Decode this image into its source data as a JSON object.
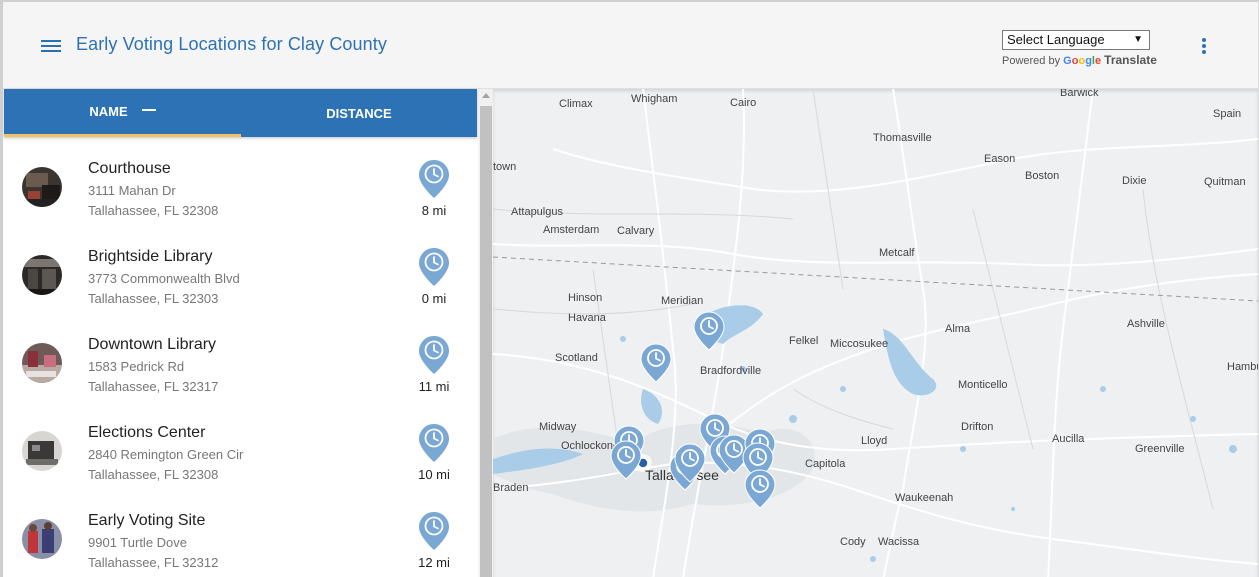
{
  "header": {
    "title": "Early Voting Locations for Clay County",
    "language_select": "Select Language",
    "powered_by": "Powered by",
    "google": [
      "G",
      "o",
      "o",
      "g",
      "l",
      "e"
    ],
    "translate": "Translate"
  },
  "tabs": {
    "name": "NAME",
    "distance": "DISTANCE"
  },
  "locations": [
    {
      "name": "Courthouse",
      "address": "3111 Mahan Dr",
      "city": "Tallahassee, FL 32308",
      "distance": "8 mi"
    },
    {
      "name": "Brightside Library",
      "address": "3773 Commonwealth Blvd",
      "city": "Tallahassee, FL 32303",
      "distance": "0 mi"
    },
    {
      "name": "Downtown Library",
      "address": "1583 Pedrick Rd",
      "city": "Tallahassee, FL 32317",
      "distance": "11 mi"
    },
    {
      "name": "Elections Center",
      "address": "2840 Remington Green Cir",
      "city": "Tallahassee, FL 32308",
      "distance": "10 mi"
    },
    {
      "name": "Early Voting Site",
      "address": "9901 Turtle Dove",
      "city": "Tallahassee, FL 32312",
      "distance": "12 mi"
    }
  ],
  "map": {
    "places": [
      "Climax",
      "Whigham",
      "Cairo",
      "Barwick",
      "Spain",
      "Thomasville",
      "town",
      "Eason",
      "Boston",
      "Dixie",
      "Quitman",
      "Attapulgus",
      "Amsterdam",
      "Calvary",
      "Metcalf",
      "Hinson",
      "Meridian",
      "Havana",
      "Ashville",
      "Alma",
      "Felkel",
      "Miccosukee",
      "Scotland",
      "Bradfordville",
      "Monticello",
      "Hambur",
      "Drifton",
      "Midway",
      "Ochlockonee",
      "Lloyd",
      "Aucilla",
      "Greenville",
      "Capitola",
      "Tallahassee",
      "Braden",
      "Waukeenah",
      "Cody",
      "Wacissa"
    ]
  },
  "colors": {
    "primary": "#2d72b5",
    "accent": "#f0c36b",
    "pin": "#7aa7d3"
  }
}
